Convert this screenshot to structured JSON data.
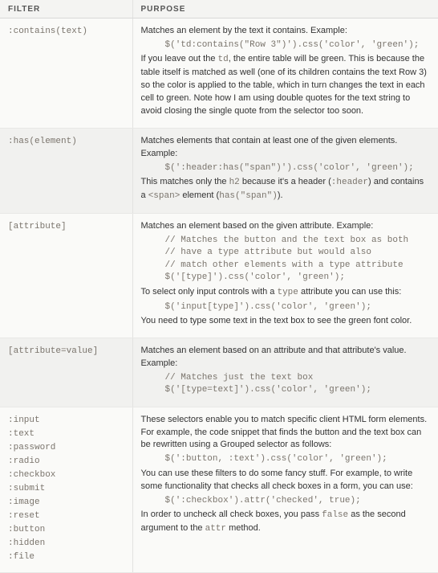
{
  "header": {
    "filter": "FILTER",
    "purpose": "PURPOSE"
  },
  "rows": [
    {
      "filter_items": [
        ":contains(text)"
      ],
      "purpose_parts": [
        {
          "type": "text",
          "content": "Matches an element by the text it contains. Example:"
        },
        {
          "type": "code",
          "content": "$('td:contains(\"Row 3\")').css('color', 'green');"
        },
        {
          "type": "mixed",
          "segments": [
            {
              "t": "plain",
              "v": "If you leave out the "
            },
            {
              "t": "mono",
              "v": "td"
            },
            {
              "t": "plain",
              "v": ", the entire table will be green. This is because the table itself is matched as well (one of its children contains the text Row 3) so the color is applied to the table, which in turn changes the text in each cell to green. Note how I am using double quotes for the text string to avoid closing the single quote from the selector too soon."
            }
          ]
        }
      ]
    },
    {
      "filter_items": [
        ":has(element)"
      ],
      "purpose_parts": [
        {
          "type": "text",
          "content": "Matches elements that contain at least one of the given elements. Example:"
        },
        {
          "type": "code",
          "content": "$(':header:has(\"span\")').css('color', 'green');"
        },
        {
          "type": "mixed",
          "segments": [
            {
              "t": "plain",
              "v": "This matches only the "
            },
            {
              "t": "mono",
              "v": "h2"
            },
            {
              "t": "plain",
              "v": " because it's a header ("
            },
            {
              "t": "mono",
              "v": ":header"
            },
            {
              "t": "plain",
              "v": ") and contains a "
            },
            {
              "t": "mono",
              "v": "<span>"
            },
            {
              "t": "plain",
              "v": " element ("
            },
            {
              "t": "mono",
              "v": "has(\"span\")"
            },
            {
              "t": "plain",
              "v": ")."
            }
          ]
        }
      ]
    },
    {
      "filter_items": [
        "[attribute]"
      ],
      "purpose_parts": [
        {
          "type": "text",
          "content": "Matches an element based on the given attribute. Example:"
        },
        {
          "type": "code",
          "content": "// Matches the button and the text box as both\n// have a type attribute but would also\n// match other elements with a type attribute\n$('[type]').css('color', 'green');"
        },
        {
          "type": "mixed",
          "segments": [
            {
              "t": "plain",
              "v": "To select only input controls with a "
            },
            {
              "t": "mono",
              "v": "type"
            },
            {
              "t": "plain",
              "v": " attribute you can use this:"
            }
          ]
        },
        {
          "type": "code",
          "content": "$('input[type]').css('color', 'green');"
        },
        {
          "type": "text",
          "content": "You need to type some text in the text box to see the green font color."
        }
      ]
    },
    {
      "filter_items": [
        "[attribute=value]"
      ],
      "purpose_parts": [
        {
          "type": "text",
          "content": "Matches an element based on an attribute and that attribute's value. Example:"
        },
        {
          "type": "code",
          "content": "// Matches just the text box\n$('[type=text]').css('color', 'green');"
        }
      ]
    },
    {
      "filter_items": [
        ":input",
        ":text",
        ":password",
        ":radio",
        ":checkbox",
        ":submit",
        ":image",
        ":reset",
        ":button",
        ":hidden",
        ":file"
      ],
      "purpose_parts": [
        {
          "type": "text",
          "content": "These selectors enable you to match specific client HTML form elements. For example, the code snippet that finds the button and the text box can be rewritten using a Grouped selector as follows:"
        },
        {
          "type": "code",
          "content": "$(':button, :text').css('color', 'green');"
        },
        {
          "type": "text",
          "content": "You can use these filters to do some fancy stuff. For example, to write some functionality that checks all check boxes in a form, you can use:"
        },
        {
          "type": "code",
          "content": "$(':checkbox').attr('checked', true);"
        },
        {
          "type": "mixed",
          "segments": [
            {
              "t": "plain",
              "v": "In order to uncheck all check boxes, you pass "
            },
            {
              "t": "mono",
              "v": "false"
            },
            {
              "t": "plain",
              "v": " as the second argument to the "
            },
            {
              "t": "mono",
              "v": "attr"
            },
            {
              "t": "plain",
              "v": " method."
            }
          ]
        }
      ]
    }
  ]
}
